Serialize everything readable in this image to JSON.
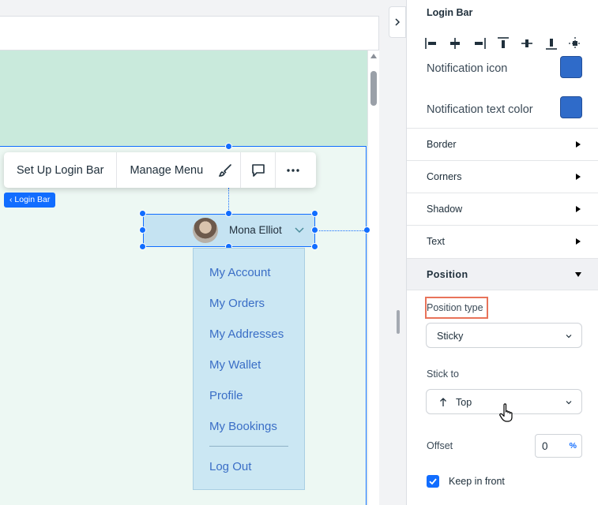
{
  "toolbar": {
    "setup_label": "Set Up Login Bar",
    "manage_label": "Manage Menu",
    "design_icon": "brush-icon",
    "comment_icon": "comment-icon",
    "more_icon": "more-icon"
  },
  "element_tag": "‹ Login Bar",
  "login_bar": {
    "user_name": "Mona Elliot",
    "avatar_icon": "avatar"
  },
  "member_menu": {
    "items": [
      "My Account",
      "My Orders",
      "My Addresses",
      "My Wallet",
      "Profile",
      "My Bookings"
    ],
    "logout": "Log Out"
  },
  "panel": {
    "title": "Login Bar",
    "align_icons": [
      "align-left-icon",
      "align-center-h-icon",
      "align-right-icon",
      "align-top-icon",
      "align-center-v-icon",
      "align-bottom-icon",
      "align-center-icon"
    ],
    "color_rows": [
      {
        "label": "Notification icon",
        "color": "#2f6bc9"
      },
      {
        "label": "Notification text color",
        "color": "#2f6bc9"
      }
    ],
    "sections": [
      "Border",
      "Corners",
      "Shadow",
      "Text"
    ],
    "position": {
      "title": "Position",
      "type_label": "Position type",
      "type_value": "Sticky",
      "stick_label": "Stick to",
      "stick_value": "Top",
      "offset_label": "Offset",
      "offset_value": "0",
      "offset_unit": "%",
      "keep_front_label": "Keep in front",
      "keep_front_checked": true
    }
  },
  "colors": {
    "accent": "#116dff",
    "highlight": "#e8735a",
    "header_band": "#c9eadc",
    "page_bg": "#edf8f3",
    "menu_bg": "#cbe7f3"
  }
}
